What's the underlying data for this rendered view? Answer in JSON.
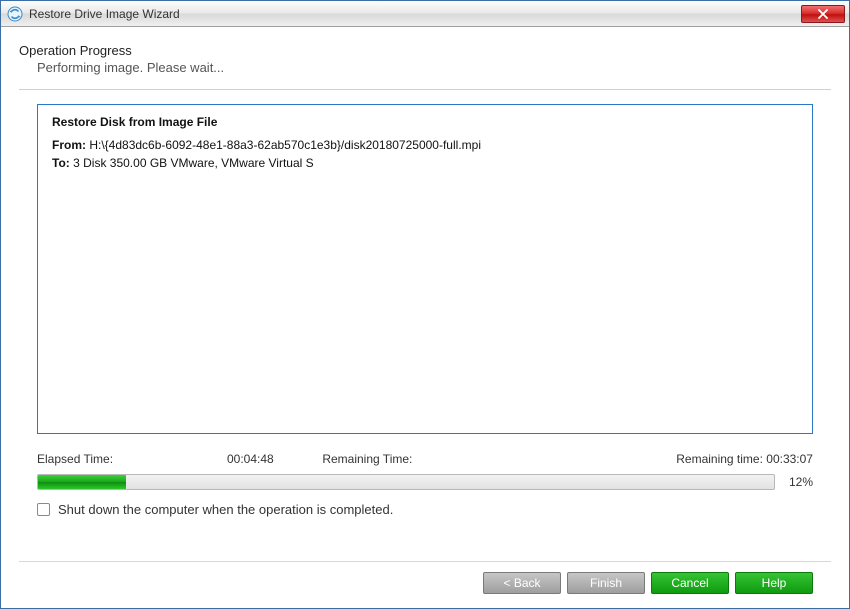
{
  "window": {
    "title": "Restore Drive Image Wizard"
  },
  "header": {
    "title": "Operation Progress",
    "subtitle": "Performing image. Please wait..."
  },
  "details": {
    "title": "Restore Disk from Image File",
    "from_label": "From:",
    "from_value": "H:\\{4d83dc6b-6092-48e1-88a3-62ab570c1e3b}/disk20180725000-full.mpi",
    "to_label": "To:",
    "to_value": "3 Disk 350.00 GB VMware, VMware Virtual S"
  },
  "time": {
    "elapsed_label": "Elapsed Time:",
    "elapsed_value": "00:04:48",
    "remaining_label": "Remaining Time:",
    "remaining_text": "Remaining time: 00:33:07"
  },
  "progress": {
    "percent_text": "12%",
    "percent_value": 12
  },
  "shutdown": {
    "label": "Shut down the computer when the operation is completed.",
    "checked": false
  },
  "buttons": {
    "back": "< Back",
    "finish": "Finish",
    "cancel": "Cancel",
    "help": "Help"
  }
}
